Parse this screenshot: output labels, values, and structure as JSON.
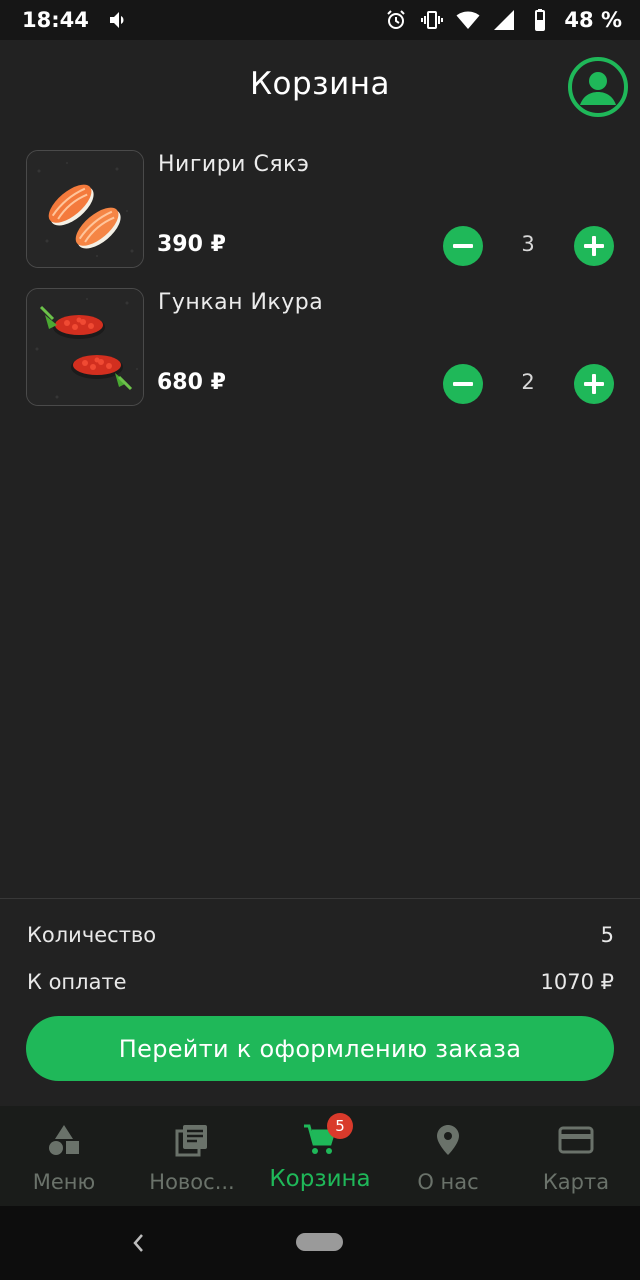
{
  "status_bar": {
    "time": "18:44",
    "battery": "48 %",
    "icons": [
      "volume-icon",
      "alarm-icon",
      "vibrate-icon",
      "wifi-icon",
      "signal-icon",
      "battery-icon"
    ]
  },
  "header": {
    "title": "Корзина",
    "profile_icon": "account-circle-icon"
  },
  "cart": {
    "items": [
      {
        "name": "Нигири Сякэ",
        "price": "390 ₽",
        "quantity": "3",
        "image": "nigiri-salmon-image"
      },
      {
        "name": "Гункан Икура",
        "price": "680 ₽",
        "quantity": "2",
        "image": "gunkan-ikura-image"
      }
    ]
  },
  "summary": {
    "count_label": "Количество",
    "count_value": "5",
    "total_label": "К оплате",
    "total_value": "1070 ₽",
    "checkout_label": "Перейти к оформлению заказа"
  },
  "bottom_nav": {
    "items": [
      {
        "label": "Меню",
        "icon": "shapes-icon",
        "active": false
      },
      {
        "label": "Новос...",
        "icon": "newspaper-icon",
        "active": false
      },
      {
        "label": "Корзина",
        "icon": "cart-icon",
        "active": true,
        "badge": "5"
      },
      {
        "label": "О нас",
        "icon": "location-pin-icon",
        "active": false
      },
      {
        "label": "Карта",
        "icon": "credit-card-icon",
        "active": false
      }
    ]
  },
  "colors": {
    "accent": "#1fb859",
    "background": "#222222",
    "badge": "#d93a2b",
    "nav_inactive": "#6a726a"
  }
}
